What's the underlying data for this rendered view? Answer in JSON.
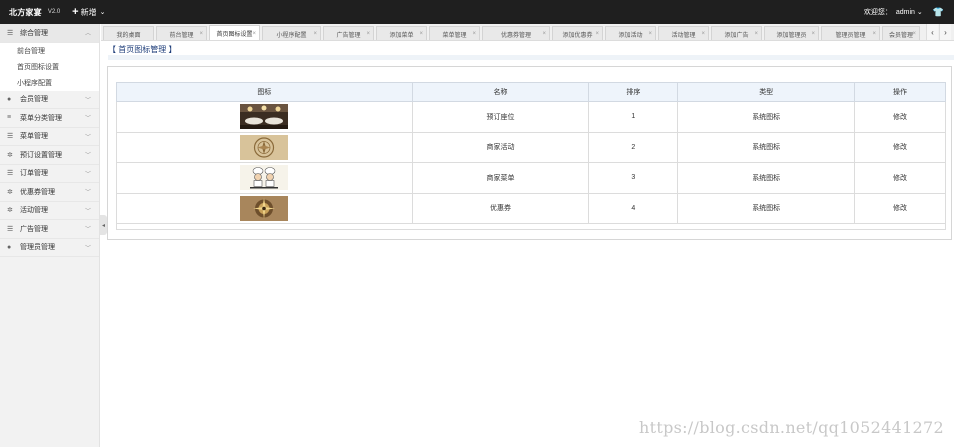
{
  "header": {
    "brand": "北方家宴",
    "version": "V2.0",
    "new_label": "新增",
    "welcome": "欢迎您：",
    "username": "admin"
  },
  "sidebar": {
    "groups": [
      {
        "label": "综合管理",
        "icon": "list-icon",
        "open": true
      },
      {
        "label": "会员管理",
        "icon": "user-icon"
      },
      {
        "label": "菜单分类管理",
        "icon": "layers-icon"
      },
      {
        "label": "菜单管理",
        "icon": "list-icon"
      },
      {
        "label": "预订设置管理",
        "icon": "gear-icon"
      },
      {
        "label": "订单管理",
        "icon": "list-icon"
      },
      {
        "label": "优惠券管理",
        "icon": "gear-icon"
      },
      {
        "label": "活动管理",
        "icon": "gear-icon"
      },
      {
        "label": "广告管理",
        "icon": "list-icon"
      },
      {
        "label": "管理员管理",
        "icon": "user-icon"
      }
    ],
    "sub_items": [
      "前台管理",
      "首页图标设置",
      "小程序配置"
    ]
  },
  "tabs": [
    "我的桌面",
    "前台管理",
    "首页图标设置",
    "小程序配置",
    "广告管理",
    "添加菜单",
    "菜单管理",
    "优惠券管理",
    "添加优惠券",
    "添加活动",
    "活动管理",
    "添加广告",
    "添加管理员",
    "管理员管理",
    "会员管理"
  ],
  "active_tab": 2,
  "breadcrumb": "【 首页图标管理 】",
  "table": {
    "headers": [
      "图标",
      "名称",
      "排序",
      "类型",
      "操作"
    ],
    "rows": [
      {
        "icon": "restaurant-photo",
        "name": "预订座位",
        "order": "1",
        "type": "系统图标",
        "action": "修改"
      },
      {
        "icon": "emblem-photo",
        "name": "商家活动",
        "order": "2",
        "type": "系统图标",
        "action": "修改"
      },
      {
        "icon": "chef-photo",
        "name": "商家菜单",
        "order": "3",
        "type": "系统图标",
        "action": "修改"
      },
      {
        "icon": "compass-photo",
        "name": "优惠券",
        "order": "4",
        "type": "系统图标",
        "action": "修改"
      }
    ]
  },
  "watermark": "https://blog.csdn.net/qq1052441272"
}
